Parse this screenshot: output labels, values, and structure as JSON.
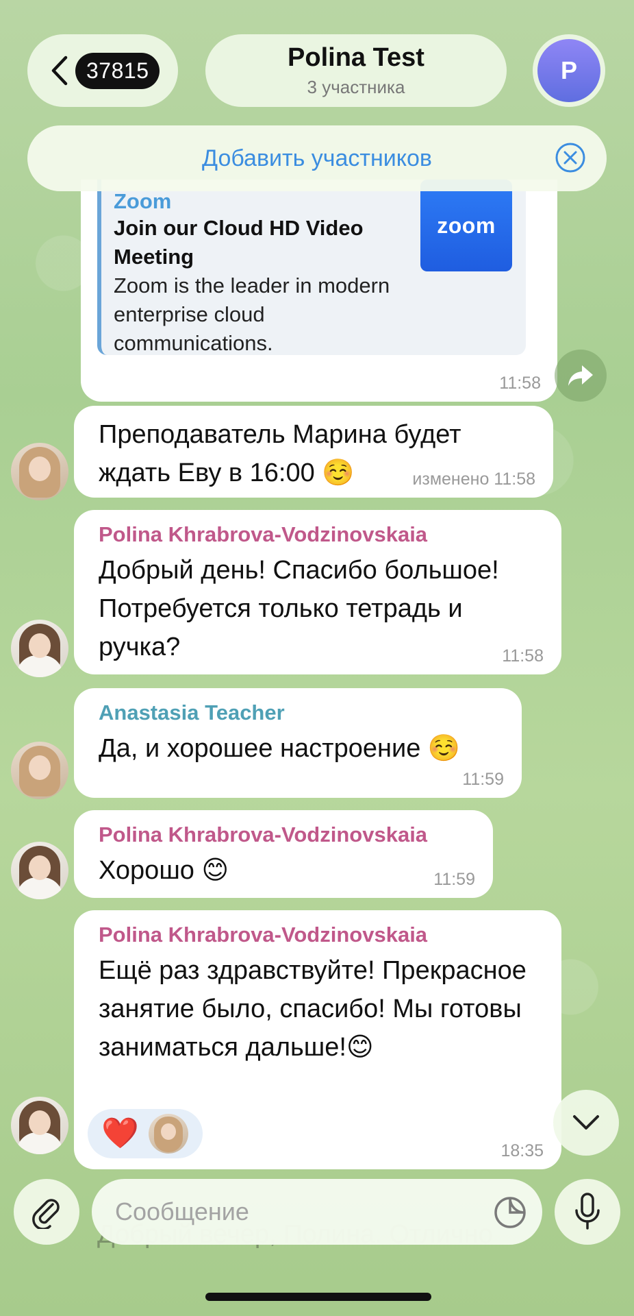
{
  "header": {
    "unread_count": "37815",
    "chat_title": "Polina Test",
    "chat_subtitle": "3 участника",
    "avatar_letter": "P"
  },
  "banner": {
    "add_members": "Добавить участников"
  },
  "link_preview": {
    "site": "Zoom",
    "title": "Join our Cloud HD Video Meeting",
    "description": "Zoom is the leader in modern enterprise cloud communications.",
    "logo_text": "zoom",
    "time": "11:58"
  },
  "messages": [
    {
      "text": "Преподаватель Марина будет ждать Еву в 16:00 ☺️",
      "time": "изменено 11:58"
    },
    {
      "sender": "Polina Khrabrova-Vodzinovskaia",
      "text": "Добрый день! Спасибо большое! Потребуется только тетрадь и ручка?",
      "time": "11:58"
    },
    {
      "sender": "Anastasia Teacher",
      "text": "Да, и хорошее настроение ☺️",
      "time": "11:59"
    },
    {
      "sender": "Polina Khrabrova-Vodzinovskaia",
      "text": "Хорошо 😊",
      "time": "11:59"
    },
    {
      "sender": "Polina Khrabrova-Vodzinovskaia",
      "text": "Ещё раз здравствуйте! Прекрасное занятие было, спасибо! Мы готовы заниматься дальше!😊",
      "time": "18:35",
      "reaction": "❤️"
    }
  ],
  "behind_text": "Добрый вечер, Полина. Отлично",
  "input": {
    "placeholder": "Сообщение"
  },
  "colors": {
    "accent": "#3b8de0",
    "sender_pink": "#c0588a",
    "sender_teal": "#4fa0b5"
  }
}
